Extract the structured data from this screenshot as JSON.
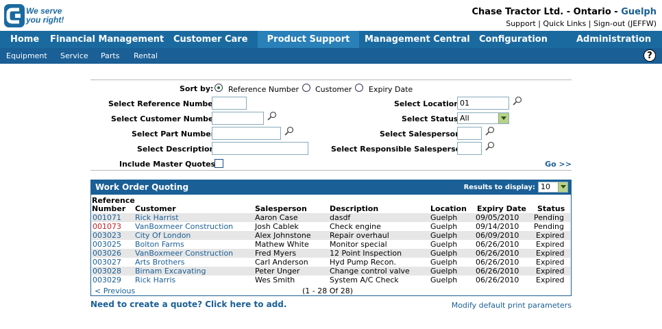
{
  "logo": {
    "line1": "We serve",
    "line2": "you right!"
  },
  "header": {
    "company": "Chase Tractor Ltd. - Ontario - ",
    "location": "Guelph"
  },
  "toplinks": {
    "support": "Support",
    "quick_links": "Quick Links",
    "sign_out": "Sign-out (JEFFW)",
    "sep": "|"
  },
  "mainnav": [
    "Home",
    "Financial Management",
    "Customer Care",
    "Product Support",
    "Management Central",
    "Configuration",
    "Administration"
  ],
  "subnav": [
    "Equipment",
    "Service",
    "Parts",
    "Rental"
  ],
  "help": "?",
  "form": {
    "sort_by": "Sort by:",
    "sort_options": [
      "Reference Number",
      "Customer",
      "Expiry Date"
    ],
    "ref_label": "Select Reference Number:",
    "cust_label": "Select Customer Number:",
    "part_label": "Select Part Number:",
    "desc_label": "Select Description:",
    "master_label": "Include Master Quotes:",
    "location_label": "Select Location:",
    "location_value": "01",
    "status_label": "Select Status:",
    "status_value": "All",
    "salesperson_label": "Select Salesperson:",
    "resp_label": "Select Responsible Salesperson:",
    "go": "Go >>"
  },
  "panel": {
    "title": "Work Order Quoting",
    "results_label": "Results to display:",
    "results_value": "10",
    "headers": {
      "ref1": "Reference",
      "ref2": "Number",
      "customer": "Customer",
      "salesperson": "Salesperson",
      "description": "Description",
      "location": "Location",
      "expiry": "Expiry Date",
      "status": "Status"
    },
    "rows": [
      {
        "ref": "001071",
        "customer": "Rick Harrist",
        "salesperson": "Aaron Case",
        "description": "dasdf",
        "location": "Guelph",
        "expiry": "09/05/2010",
        "status": "Pending"
      },
      {
        "ref": "001073",
        "customer": "VanBoxmeer Construction",
        "salesperson": "Josh Cablek",
        "description": "Check engine",
        "location": "Guelph",
        "expiry": "09/14/2010",
        "status": "Pending"
      },
      {
        "ref": "003023",
        "customer": "City Of London",
        "salesperson": "Alex Johnstone",
        "description": "Repair overhaul",
        "location": "Guelph",
        "expiry": "06/09/2010",
        "status": "Expired"
      },
      {
        "ref": "003025",
        "customer": "Bolton Farms",
        "salesperson": "Mathew White",
        "description": "Monitor special",
        "location": "Guelph",
        "expiry": "06/26/2010",
        "status": "Expired"
      },
      {
        "ref": "003026",
        "customer": "VanBoxmeer Construction",
        "salesperson": "Fred Myers",
        "description": "12 Point Inspection",
        "location": "Guelph",
        "expiry": "06/26/2010",
        "status": "Expired"
      },
      {
        "ref": "003027",
        "customer": "Arts Brothers",
        "salesperson": "Carl Anderson",
        "description": "Hyd Pump Recon.",
        "location": "Guelph",
        "expiry": "06/26/2010",
        "status": "Expired"
      },
      {
        "ref": "003028",
        "customer": "Birnam Excavating",
        "salesperson": "Peter Unger",
        "description": "Change control valve",
        "location": "Guelph",
        "expiry": "06/26/2010",
        "status": "Expired"
      },
      {
        "ref": "003029",
        "customer": "Rick Harris",
        "salesperson": "Wes Smith",
        "description": "System A/C Check",
        "location": "Guelph",
        "expiry": "06/26/2010",
        "status": "Expired"
      }
    ],
    "prev": "< Previous",
    "pager": "(1 - 28 Of 28)"
  },
  "footer": {
    "create": "Need to create a quote? Click here to add.",
    "print": "Modify default print parameters"
  },
  "colors": {
    "brand": "#1a6aa0",
    "nav_dark": "#1a5f96",
    "link": "#1a5f96",
    "red_ref": "#c42020"
  }
}
